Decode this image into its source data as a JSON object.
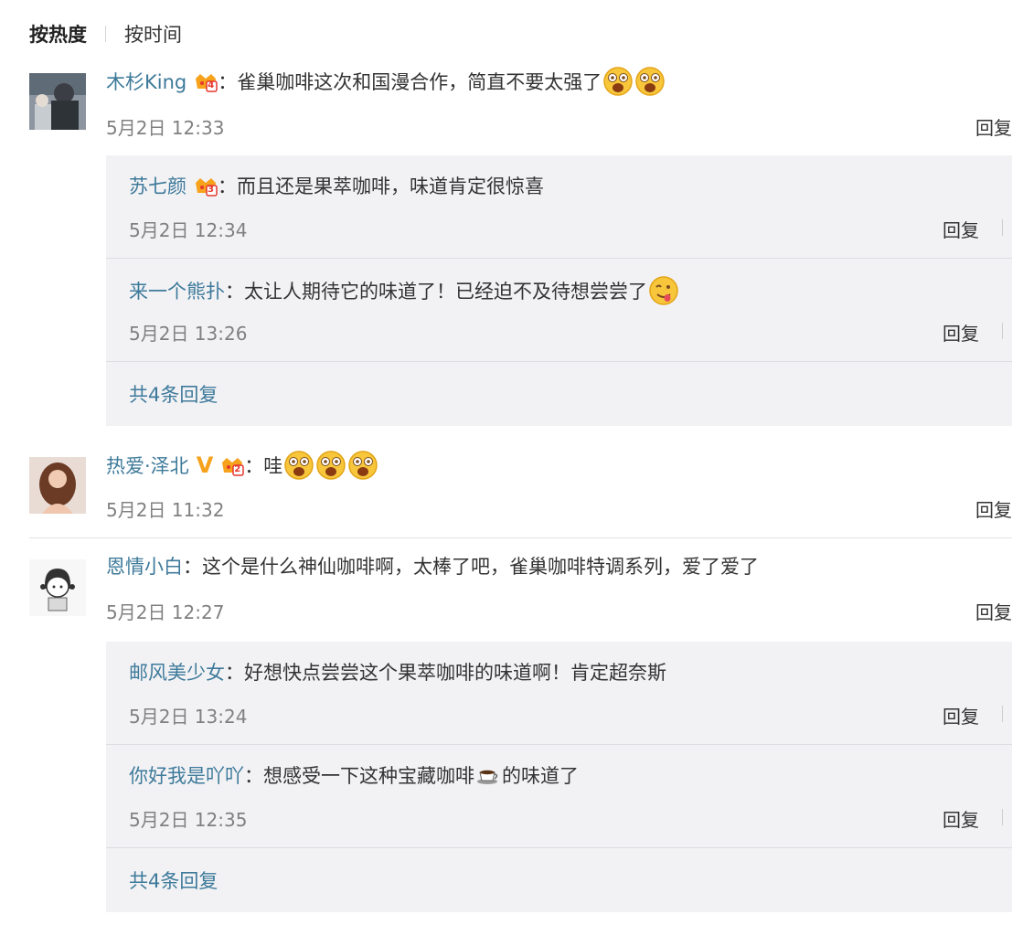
{
  "sort": {
    "hot": "按热度",
    "time": "按时间"
  },
  "comments": [
    {
      "user": "木杉King",
      "text": "雀巢咖啡这次和国漫合作，简直不要太强了",
      "time": "5月2日 12:33",
      "reply": "回复",
      "crown_level": "4",
      "replies": [
        {
          "user": "苏七颜",
          "text": "而且还是果萃咖啡，味道肯定很惊喜",
          "time": "5月2日 12:34",
          "reply": "回复",
          "crown_level": "3"
        },
        {
          "user": "来一个熊扑",
          "text": "太让人期待它的味道了！已经迫不及待想尝尝了",
          "time": "5月2日 13:26",
          "reply": "回复"
        }
      ],
      "more": "共4条回复"
    },
    {
      "user": "热爱·泽北",
      "verified": "V",
      "text": "哇",
      "time": "5月2日 11:32",
      "reply": "回复",
      "crown_level": "2"
    },
    {
      "user": "恩情小白",
      "text": "这个是什么神仙咖啡啊，太棒了吧，雀巢咖啡特调系列，爱了爱了",
      "time": "5月2日 12:27",
      "reply": "回复",
      "replies": [
        {
          "user": "邮风美少女",
          "text": "好想快点尝尝这个果萃咖啡的味道啊！肯定超奈斯",
          "time": "5月2日 13:24",
          "reply": "回复"
        },
        {
          "user": "你好我是吖吖",
          "text_before": "想感受一下这种宝藏咖啡",
          "text_after": "的味道了",
          "time": "5月2日 12:35",
          "reply": "回复"
        }
      ],
      "more": "共4条回复"
    }
  ],
  "colors": {
    "username": "#3e7a9a",
    "meta": "#808080",
    "reply_bg": "#f2f2f5",
    "crown": "#f6a21c"
  },
  "icons": [
    "crown-level-badge",
    "wow-emoji",
    "yum-emoji",
    "coffee-cup-emoji",
    "verified-v-icon"
  ]
}
